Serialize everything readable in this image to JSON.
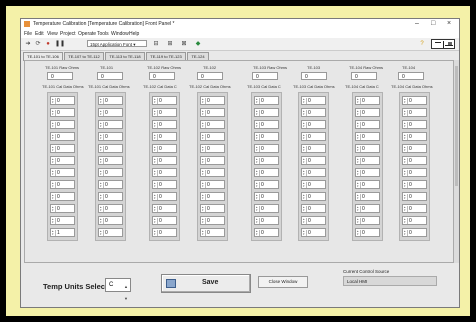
{
  "window": {
    "title": "Temperature Calibration [Temperature Calibration] Front Panel *",
    "controls": [
      "–",
      "□",
      "×"
    ]
  },
  "menu": [
    "File",
    "Edit",
    "View",
    "Project",
    "Operate",
    "Tools",
    "Window",
    "Help"
  ],
  "toolbar": {
    "font": "15pt Application Font ▾"
  },
  "tabs": [
    "TE-101 to TE-106",
    "TE-107 to TE-112",
    "TE-113 to TE-118",
    "TE-119 to TE-123",
    "TE-124"
  ],
  "active_tab": 0,
  "raw_fields": [
    {
      "label": "TE-101 Raw Ohms",
      "value": "0"
    },
    {
      "label": "TE-101",
      "value": "0"
    },
    {
      "label": "TE-102 Raw Ohms",
      "value": "0"
    },
    {
      "label": "TE-102",
      "value": "0"
    },
    {
      "label": "TE-103 Raw Ohms",
      "value": "0"
    },
    {
      "label": "TE-103",
      "value": "0"
    },
    {
      "label": "TE-104 Raw Ohms",
      "value": "0"
    },
    {
      "label": "TE-104",
      "value": "0"
    }
  ],
  "columns": [
    {
      "label": "TE-101 Cal Data Ohms",
      "values": [
        "0",
        "0",
        "0",
        "0",
        "0",
        "0",
        "0",
        "0",
        "0",
        "0",
        "0",
        "1"
      ]
    },
    {
      "label": "TE-101 Cal Data Ohms",
      "values": [
        "0",
        "0",
        "0",
        "0",
        "0",
        "0",
        "0",
        "0",
        "0",
        "0",
        "0",
        "0"
      ]
    },
    {
      "label": "TE-102 Cal Data C",
      "values": [
        "0",
        "0",
        "0",
        "0",
        "0",
        "0",
        "0",
        "0",
        "0",
        "0",
        "0",
        "0"
      ]
    },
    {
      "label": "TE-102 Cal Data Ohms",
      "values": [
        "0",
        "0",
        "0",
        "0",
        "0",
        "0",
        "0",
        "0",
        "0",
        "0",
        "0",
        "0"
      ]
    },
    {
      "label": "TE-103 Cal Data C",
      "values": [
        "0",
        "0",
        "0",
        "0",
        "0",
        "0",
        "0",
        "0",
        "0",
        "0",
        "0",
        "0"
      ]
    },
    {
      "label": "TE-103 Cal Data Ohms",
      "values": [
        "0",
        "0",
        "0",
        "0",
        "0",
        "0",
        "0",
        "0",
        "0",
        "0",
        "0",
        "0"
      ]
    },
    {
      "label": "TE-104 Cal Data C",
      "values": [
        "0",
        "0",
        "0",
        "0",
        "0",
        "0",
        "0",
        "0",
        "0",
        "0",
        "0",
        "0"
      ]
    },
    {
      "label": "TE-104 Cal Data Ohms",
      "values": [
        "0",
        "0",
        "0",
        "0",
        "0",
        "0",
        "0",
        "0",
        "0",
        "0",
        "0",
        "0"
      ]
    }
  ],
  "bottom": {
    "units_label": "Temp Units Select",
    "units_value": "C",
    "save_label": "Save",
    "close_label": "Close Window",
    "source_label": "Current Control Source",
    "source_value": "Local HMI"
  }
}
